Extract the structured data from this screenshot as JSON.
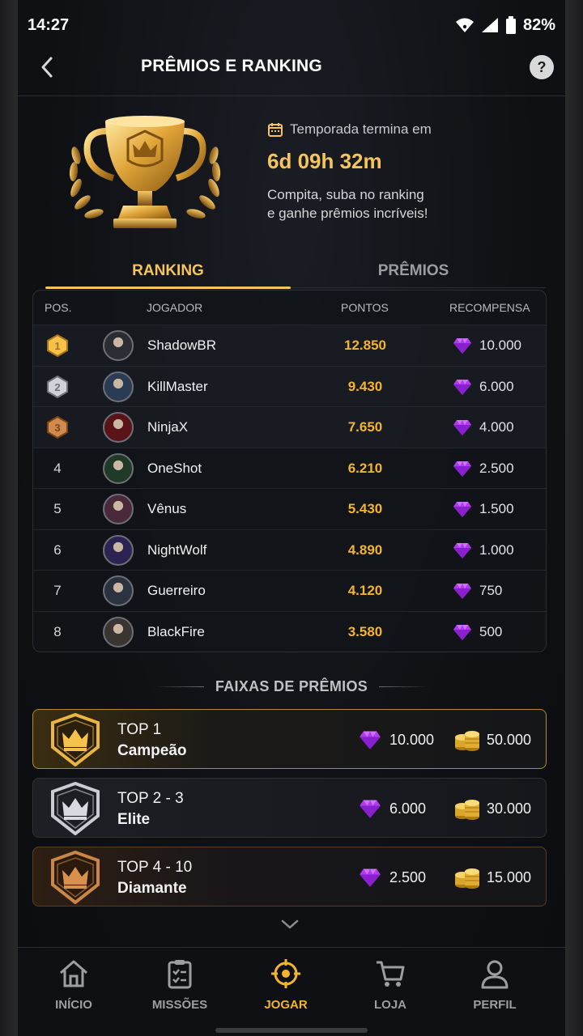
{
  "status": {
    "time": "14:27",
    "battery": "82%"
  },
  "header": {
    "title": "PRÊMIOS E RANKING",
    "help": "?"
  },
  "hero": {
    "season_label": "Temporada termina em",
    "countdown": "6d 09h 32m",
    "desc_line1": "Compita, suba no ranking",
    "desc_line2": "e ganhe prêmios incríveis!"
  },
  "tabs": {
    "ranking": "RANKING",
    "premios": "PRÊMIOS",
    "active": "ranking"
  },
  "table": {
    "headers": {
      "pos": "POS.",
      "player": "JOGADOR",
      "points": "PONTOS",
      "reward": "RECOMPENSA"
    },
    "rows": [
      {
        "pos": "1",
        "name": "ShadowBR",
        "points": "12.850",
        "reward": "10.000"
      },
      {
        "pos": "2",
        "name": "KillMaster",
        "points": "9.430",
        "reward": "6.000"
      },
      {
        "pos": "3",
        "name": "NinjaX",
        "points": "7.650",
        "reward": "4.000"
      },
      {
        "pos": "4",
        "name": "OneShot",
        "points": "6.210",
        "reward": "2.500"
      },
      {
        "pos": "5",
        "name": "Vênus",
        "points": "5.430",
        "reward": "1.500"
      },
      {
        "pos": "6",
        "name": "NightWolf",
        "points": "4.890",
        "reward": "1.000"
      },
      {
        "pos": "7",
        "name": "Guerreiro",
        "points": "4.120",
        "reward": "750"
      },
      {
        "pos": "8",
        "name": "BlackFire",
        "points": "3.580",
        "reward": "500"
      }
    ]
  },
  "tiers_section": {
    "title": "FAIXAS DE PRÊMIOS"
  },
  "tiers": [
    {
      "top": "TOP 1",
      "name": "Campeão",
      "gems": "10.000",
      "coins": "50.000"
    },
    {
      "top": "TOP 2 - 3",
      "name": "Elite",
      "gems": "6.000",
      "coins": "30.000"
    },
    {
      "top": "TOP 4 - 10",
      "name": "Diamante",
      "gems": "2.500",
      "coins": "15.000"
    }
  ],
  "nav": {
    "items": [
      {
        "label": "INÍCIO",
        "icon": "home-icon"
      },
      {
        "label": "MISSÕES",
        "icon": "clipboard-icon"
      },
      {
        "label": "JOGAR",
        "icon": "crosshair-icon"
      },
      {
        "label": "LOJA",
        "icon": "cart-icon"
      },
      {
        "label": "PERFIL",
        "icon": "user-icon"
      }
    ],
    "active": "JOGAR"
  },
  "colors": {
    "accent": "#f5c45a",
    "points": "#f5b52a",
    "gem": "#b23bf0",
    "background": "#0f1115"
  }
}
